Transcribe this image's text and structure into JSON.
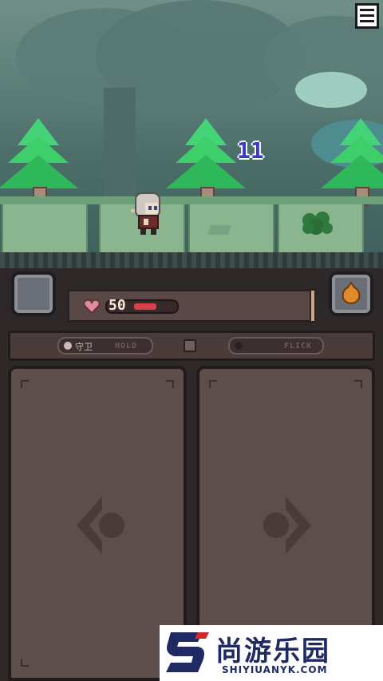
{
  "menu": {
    "icon": "hamburger-menu-icon"
  },
  "battle": {
    "damage_number": "11"
  },
  "player": {
    "hp_value": "50",
    "hp_fraction": 0.55
  },
  "controls": {
    "guard_label": "守卫",
    "hold_label": "HOLD",
    "flick_label": "FLICK"
  },
  "cards": {
    "left_icon": "left-arrow-icon",
    "right_icon": "right-arrow-icon"
  },
  "watermark": {
    "brand_cn": "尚游乐园",
    "brand_domain": "SHIYIUANYK.COM"
  },
  "colors": {
    "tree_green": "#3ecf6a",
    "hp_red": "#d9404a",
    "damage_purple": "#3a3ad0",
    "panel_brown": "#5d4d4b",
    "watermark_navy": "#1f2a63"
  }
}
